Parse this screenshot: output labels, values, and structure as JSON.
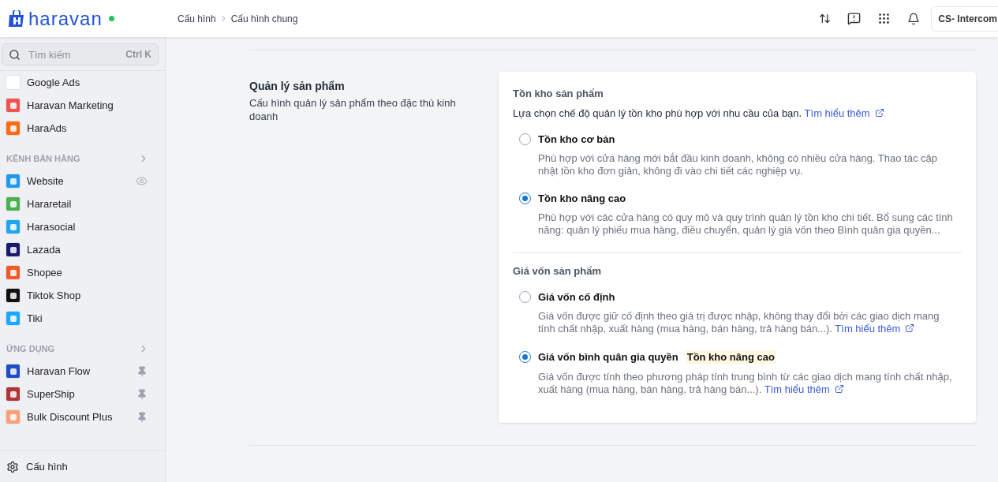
{
  "header": {
    "logo_text": "haravan",
    "online": true,
    "breadcrumb": [
      "Cấu hình",
      "Cấu hình chung"
    ],
    "account": "CS- Intercom"
  },
  "sidebar": {
    "search": {
      "placeholder": "Tìm kiếm",
      "shortcut": "Ctrl K"
    },
    "top_items": [
      {
        "label": "Google Ads",
        "color": "#ffffff"
      },
      {
        "label": "Haravan Marketing",
        "color": "#f0524f"
      },
      {
        "label": "HaraAds",
        "color": "#ff6a13"
      }
    ],
    "sections": [
      {
        "title": "KÊNH BÁN HÀNG",
        "items": [
          {
            "label": "Website",
            "color": "#1e9af0",
            "kind": "eye"
          },
          {
            "label": "Hararetail",
            "color": "#4caf50"
          },
          {
            "label": "Harasocial",
            "color": "#1fa6f0"
          },
          {
            "label": "Lazada",
            "color": "#1a1a6e"
          },
          {
            "label": "Shopee",
            "color": "#f05a28"
          },
          {
            "label": "Tiktok Shop",
            "color": "#111111"
          },
          {
            "label": "Tiki",
            "color": "#1ba8ff"
          }
        ]
      },
      {
        "title": "ỨNG DỤNG",
        "items": [
          {
            "label": "Haravan Flow",
            "color": "#1e4fc8",
            "kind": "pin"
          },
          {
            "label": "SuperShip",
            "color": "#b0343a",
            "kind": "pin"
          },
          {
            "label": "Bulk Discount Plus",
            "color": "#f9a074",
            "kind": "pin"
          }
        ]
      }
    ],
    "footer_item": {
      "label": "Cấu hình"
    }
  },
  "section": {
    "title": "Quản lý sản phẩm",
    "description": "Cấu hình quản lý sản phẩm theo đặc thù kinh doanh",
    "groups": [
      {
        "title": "Tồn kho sản phẩm",
        "intro": "Lựa chọn chế độ quản lý tồn kho phù hợp với nhu cầu của bạn.",
        "intro_link": "Tìm hiểu thêm",
        "options": [
          {
            "label": "Tồn kho cơ bản",
            "selected": false,
            "description": "Phù hợp với cửa hàng mới bắt đầu kinh doanh, không có nhiều cửa hàng. Thao tác cập nhật tồn kho đơn giản, không đi vào chi tiết các nghiệp vụ."
          },
          {
            "label": "Tồn kho nâng cao",
            "selected": true,
            "description": "Phù hợp với các cửa hàng có quy mô và quy trình quản lý tồn kho chi tiết. Bổ sung các tính năng: quản lý phiếu mua hàng, điều chuyển, quản lý giá vốn theo Bình quân gia quyền..."
          }
        ]
      },
      {
        "title": "Giá vốn sản phẩm",
        "options": [
          {
            "label": "Giá vốn cố định",
            "selected": false,
            "description": "Giá vốn được giữ cố định theo giá trị được nhập, không thay đổi bởi các giao dịch mang tính chất nhập, xuất hàng (mua hàng, bán hàng, trả hàng bán...).",
            "link": "Tìm hiểu thêm"
          },
          {
            "label": "Giá vốn bình quân gia quyền",
            "tag": "Tồn kho nâng cao",
            "selected": true,
            "description": "Giá vốn được tính theo phương pháp tính trung bình từ các giao dịch mang tính chất nhập, xuất hàng (mua hàng, bán hàng, trả hàng bán...).",
            "link": "Tìm hiểu thêm"
          }
        ]
      }
    ]
  }
}
